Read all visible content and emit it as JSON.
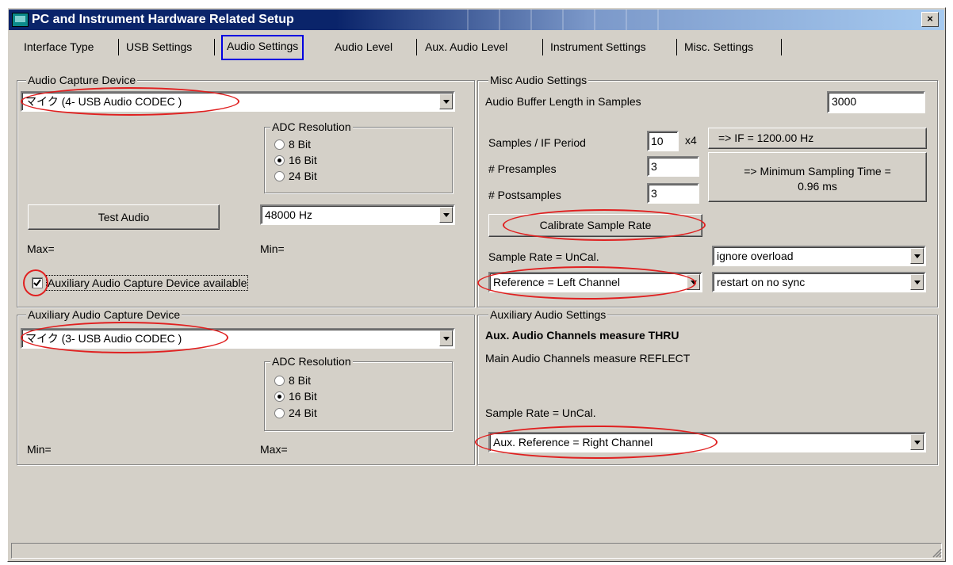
{
  "window": {
    "title": "PC and Instrument Hardware Related Setup",
    "close_glyph": "×"
  },
  "tabs": [
    "Interface Type",
    "USB Settings",
    "Audio Settings",
    "Audio Level",
    "Aux. Audio Level",
    "Instrument Settings",
    "Misc. Settings"
  ],
  "active_tab": "Audio Settings",
  "capture": {
    "group_title": "Audio Capture Device",
    "device": "マイク (4- USB Audio CODEC )",
    "adc_title": "ADC Resolution",
    "adc_options": [
      "8 Bit",
      "16 Bit",
      "24 Bit"
    ],
    "adc_selected": "16 Bit",
    "test_button": "Test Audio",
    "rate": "48000 Hz",
    "max_label": "Max=",
    "min_label": "Min=",
    "aux_checkbox_label": "Auxiliary Audio Capture Device available",
    "aux_checked": true
  },
  "misc": {
    "group_title": "Misc Audio Settings",
    "buffer_label": "Audio Buffer Length in Samples",
    "buffer_value": "3000",
    "samples_period_label": "Samples / IF Period",
    "samples_period_value": "10",
    "multiplier": "x4",
    "if_button": "=> IF =   1200.00 Hz",
    "presamples_label": "# Presamples",
    "presamples_value": "3",
    "postsamples_label": "# Postsamples",
    "postsamples_value": "3",
    "min_time_line1": "=> Minimum Sampling Time =",
    "min_time_line2": "0.96 ms",
    "calibrate_button": "Calibrate Sample Rate",
    "sample_rate_label": "Sample Rate = UnCal.",
    "overload_select": "ignore overload",
    "reference_select": "Reference = Left Channel",
    "sync_select": "restart on no sync"
  },
  "aux_capture": {
    "group_title": "Auxiliary Audio Capture Device",
    "device": "マイク (3- USB Audio CODEC )",
    "adc_title": "ADC Resolution",
    "adc_options": [
      "8 Bit",
      "16 Bit",
      "24 Bit"
    ],
    "adc_selected": "16 Bit",
    "min_label": "Min=",
    "max_label": "Max="
  },
  "aux_settings": {
    "group_title": "Auxiliary Audio Settings",
    "thru_label": "Aux. Audio Channels measure THRU",
    "reflect_label": "Main Audio Channels measure REFLECT",
    "sample_rate_label": "Sample Rate = UnCal.",
    "reference_select": "Aux. Reference = Right Channel"
  },
  "colors": {
    "annotation": "#e02020",
    "active_tab_border": "#0000e0",
    "titlebar": "#0a246a",
    "face": "#d4d0c8"
  }
}
